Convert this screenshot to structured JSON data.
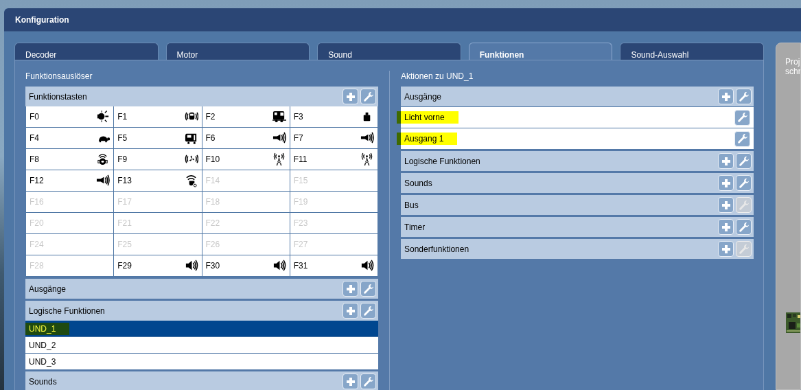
{
  "window": {
    "title": "Konfiguration"
  },
  "tabs": [
    {
      "label": "Decoder",
      "selected": false
    },
    {
      "label": "Motor",
      "selected": false
    },
    {
      "label": "Sound",
      "selected": false
    },
    {
      "label": "Funktionen",
      "selected": true
    },
    {
      "label": "Sound-Auswahl",
      "selected": false
    }
  ],
  "left_panel": {
    "title": "Funktionsauslöser",
    "sections": [
      {
        "kind": "grid",
        "title": "Funktionstasten",
        "edit_enabled": true,
        "keys": [
          {
            "label": "F0",
            "enabled": true
          },
          {
            "label": "F1",
            "enabled": true
          },
          {
            "label": "F2",
            "enabled": true
          },
          {
            "label": "F3",
            "enabled": true
          },
          {
            "label": "F4",
            "enabled": true
          },
          {
            "label": "F5",
            "enabled": true
          },
          {
            "label": "F6",
            "enabled": true
          },
          {
            "label": "F7",
            "enabled": true
          },
          {
            "label": "F8",
            "enabled": true
          },
          {
            "label": "F9",
            "enabled": true
          },
          {
            "label": "F10",
            "enabled": true
          },
          {
            "label": "F11",
            "enabled": true
          },
          {
            "label": "F12",
            "enabled": true
          },
          {
            "label": "F13",
            "enabled": true
          },
          {
            "label": "F14",
            "enabled": false
          },
          {
            "label": "F15",
            "enabled": false
          },
          {
            "label": "F16",
            "enabled": false
          },
          {
            "label": "F17",
            "enabled": false
          },
          {
            "label": "F18",
            "enabled": false
          },
          {
            "label": "F19",
            "enabled": false
          },
          {
            "label": "F20",
            "enabled": false
          },
          {
            "label": "F21",
            "enabled": false
          },
          {
            "label": "F22",
            "enabled": false
          },
          {
            "label": "F23",
            "enabled": false
          },
          {
            "label": "F24",
            "enabled": false
          },
          {
            "label": "F25",
            "enabled": false
          },
          {
            "label": "F26",
            "enabled": false
          },
          {
            "label": "F27",
            "enabled": false
          },
          {
            "label": "F28",
            "enabled": false
          },
          {
            "label": "F29",
            "enabled": true
          },
          {
            "label": "F30",
            "enabled": true
          },
          {
            "label": "F31",
            "enabled": true
          }
        ]
      },
      {
        "kind": "list",
        "title": "Ausgänge",
        "edit_enabled": true
      },
      {
        "kind": "list",
        "title": "Logische Funktionen",
        "edit_enabled": true,
        "items": [
          {
            "label": "UND_1",
            "selected": true,
            "highlighted": true
          },
          {
            "label": "UND_2",
            "selected": false,
            "highlighted": false
          },
          {
            "label": "UND_3",
            "selected": false,
            "highlighted": false
          }
        ]
      },
      {
        "kind": "list",
        "title": "Sounds",
        "edit_enabled": true
      }
    ]
  },
  "right_panel": {
    "title": "Aktionen zu UND_1",
    "sections": [
      {
        "kind": "list",
        "title": "Ausgänge",
        "edit_enabled": true,
        "items": [
          {
            "label": "Licht vorne",
            "selected": false,
            "highlighted": true
          },
          {
            "label": "Ausgang 1",
            "selected": false,
            "highlighted": true
          }
        ]
      },
      {
        "kind": "list",
        "title": "Logische Funktionen",
        "edit_enabled": true
      },
      {
        "kind": "list",
        "title": "Sounds",
        "edit_enabled": true
      },
      {
        "kind": "list",
        "title": "Bus",
        "edit_enabled": false
      },
      {
        "kind": "list",
        "title": "Timer",
        "edit_enabled": true
      },
      {
        "kind": "list",
        "title": "Sonderfunktionen",
        "edit_enabled": false
      }
    ]
  },
  "side_panel": {
    "lines": [
      "Proj",
      "schr"
    ]
  }
}
